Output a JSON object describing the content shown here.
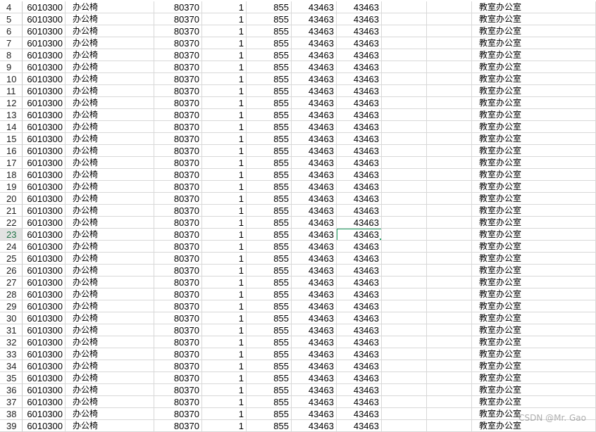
{
  "sheet": {
    "rows": [
      {
        "n": "4",
        "a": "6010300",
        "b": "办公椅",
        "c": "80370",
        "d": "1",
        "e": "855",
        "f": "43463",
        "g": "43463",
        "h": "教室办公室"
      },
      {
        "n": "5",
        "a": "6010300",
        "b": "办公椅",
        "c": "80370",
        "d": "1",
        "e": "855",
        "f": "43463",
        "g": "43463",
        "h": "教室办公室"
      },
      {
        "n": "6",
        "a": "6010300",
        "b": "办公椅",
        "c": "80370",
        "d": "1",
        "e": "855",
        "f": "43463",
        "g": "43463",
        "h": "教室办公室"
      },
      {
        "n": "7",
        "a": "6010300",
        "b": "办公椅",
        "c": "80370",
        "d": "1",
        "e": "855",
        "f": "43463",
        "g": "43463",
        "h": "教室办公室"
      },
      {
        "n": "8",
        "a": "6010300",
        "b": "办公椅",
        "c": "80370",
        "d": "1",
        "e": "855",
        "f": "43463",
        "g": "43463",
        "h": "教室办公室"
      },
      {
        "n": "9",
        "a": "6010300",
        "b": "办公椅",
        "c": "80370",
        "d": "1",
        "e": "855",
        "f": "43463",
        "g": "43463",
        "h": "教室办公室"
      },
      {
        "n": "10",
        "a": "6010300",
        "b": "办公椅",
        "c": "80370",
        "d": "1",
        "e": "855",
        "f": "43463",
        "g": "43463",
        "h": "教室办公室"
      },
      {
        "n": "11",
        "a": "6010300",
        "b": "办公椅",
        "c": "80370",
        "d": "1",
        "e": "855",
        "f": "43463",
        "g": "43463",
        "h": "教室办公室"
      },
      {
        "n": "12",
        "a": "6010300",
        "b": "办公椅",
        "c": "80370",
        "d": "1",
        "e": "855",
        "f": "43463",
        "g": "43463",
        "h": "教室办公室"
      },
      {
        "n": "13",
        "a": "6010300",
        "b": "办公椅",
        "c": "80370",
        "d": "1",
        "e": "855",
        "f": "43463",
        "g": "43463",
        "h": "教室办公室"
      },
      {
        "n": "14",
        "a": "6010300",
        "b": "办公椅",
        "c": "80370",
        "d": "1",
        "e": "855",
        "f": "43463",
        "g": "43463",
        "h": "教室办公室"
      },
      {
        "n": "15",
        "a": "6010300",
        "b": "办公椅",
        "c": "80370",
        "d": "1",
        "e": "855",
        "f": "43463",
        "g": "43463",
        "h": "教室办公室"
      },
      {
        "n": "16",
        "a": "6010300",
        "b": "办公椅",
        "c": "80370",
        "d": "1",
        "e": "855",
        "f": "43463",
        "g": "43463",
        "h": "教室办公室"
      },
      {
        "n": "17",
        "a": "6010300",
        "b": "办公椅",
        "c": "80370",
        "d": "1",
        "e": "855",
        "f": "43463",
        "g": "43463",
        "h": "教室办公室"
      },
      {
        "n": "18",
        "a": "6010300",
        "b": "办公椅",
        "c": "80370",
        "d": "1",
        "e": "855",
        "f": "43463",
        "g": "43463",
        "h": "教室办公室"
      },
      {
        "n": "19",
        "a": "6010300",
        "b": "办公椅",
        "c": "80370",
        "d": "1",
        "e": "855",
        "f": "43463",
        "g": "43463",
        "h": "教室办公室"
      },
      {
        "n": "20",
        "a": "6010300",
        "b": "办公椅",
        "c": "80370",
        "d": "1",
        "e": "855",
        "f": "43463",
        "g": "43463",
        "h": "教室办公室"
      },
      {
        "n": "21",
        "a": "6010300",
        "b": "办公椅",
        "c": "80370",
        "d": "1",
        "e": "855",
        "f": "43463",
        "g": "43463",
        "h": "教室办公室"
      },
      {
        "n": "22",
        "a": "6010300",
        "b": "办公椅",
        "c": "80370",
        "d": "1",
        "e": "855",
        "f": "43463",
        "g": "43463",
        "h": "教室办公室"
      },
      {
        "n": "23",
        "a": "6010300",
        "b": "办公椅",
        "c": "80370",
        "d": "1",
        "e": "855",
        "f": "43463",
        "g": "43463",
        "h": "教室办公室"
      },
      {
        "n": "24",
        "a": "6010300",
        "b": "办公椅",
        "c": "80370",
        "d": "1",
        "e": "855",
        "f": "43463",
        "g": "43463",
        "h": "教室办公室"
      },
      {
        "n": "25",
        "a": "6010300",
        "b": "办公椅",
        "c": "80370",
        "d": "1",
        "e": "855",
        "f": "43463",
        "g": "43463",
        "h": "教室办公室"
      },
      {
        "n": "26",
        "a": "6010300",
        "b": "办公椅",
        "c": "80370",
        "d": "1",
        "e": "855",
        "f": "43463",
        "g": "43463",
        "h": "教室办公室"
      },
      {
        "n": "27",
        "a": "6010300",
        "b": "办公椅",
        "c": "80370",
        "d": "1",
        "e": "855",
        "f": "43463",
        "g": "43463",
        "h": "教室办公室"
      },
      {
        "n": "28",
        "a": "6010300",
        "b": "办公椅",
        "c": "80370",
        "d": "1",
        "e": "855",
        "f": "43463",
        "g": "43463",
        "h": "教室办公室"
      },
      {
        "n": "29",
        "a": "6010300",
        "b": "办公椅",
        "c": "80370",
        "d": "1",
        "e": "855",
        "f": "43463",
        "g": "43463",
        "h": "教室办公室"
      },
      {
        "n": "30",
        "a": "6010300",
        "b": "办公椅",
        "c": "80370",
        "d": "1",
        "e": "855",
        "f": "43463",
        "g": "43463",
        "h": "教室办公室"
      },
      {
        "n": "31",
        "a": "6010300",
        "b": "办公椅",
        "c": "80370",
        "d": "1",
        "e": "855",
        "f": "43463",
        "g": "43463",
        "h": "教室办公室"
      },
      {
        "n": "32",
        "a": "6010300",
        "b": "办公椅",
        "c": "80370",
        "d": "1",
        "e": "855",
        "f": "43463",
        "g": "43463",
        "h": "教室办公室"
      },
      {
        "n": "33",
        "a": "6010300",
        "b": "办公椅",
        "c": "80370",
        "d": "1",
        "e": "855",
        "f": "43463",
        "g": "43463",
        "h": "教室办公室"
      },
      {
        "n": "34",
        "a": "6010300",
        "b": "办公椅",
        "c": "80370",
        "d": "1",
        "e": "855",
        "f": "43463",
        "g": "43463",
        "h": "教室办公室"
      },
      {
        "n": "35",
        "a": "6010300",
        "b": "办公椅",
        "c": "80370",
        "d": "1",
        "e": "855",
        "f": "43463",
        "g": "43463",
        "h": "教室办公室"
      },
      {
        "n": "36",
        "a": "6010300",
        "b": "办公椅",
        "c": "80370",
        "d": "1",
        "e": "855",
        "f": "43463",
        "g": "43463",
        "h": "教室办公室"
      },
      {
        "n": "37",
        "a": "6010300",
        "b": "办公椅",
        "c": "80370",
        "d": "1",
        "e": "855",
        "f": "43463",
        "g": "43463",
        "h": "教室办公室"
      },
      {
        "n": "38",
        "a": "6010300",
        "b": "办公椅",
        "c": "80370",
        "d": "1",
        "e": "855",
        "f": "43463",
        "g": "43463",
        "h": "教室办公室"
      },
      {
        "n": "39",
        "a": "6010300",
        "b": "办公椅",
        "c": "80370",
        "d": "1",
        "e": "855",
        "f": "43463",
        "g": "43463",
        "h": "教室办公室"
      }
    ],
    "active_row": "23",
    "selection_color": "#21a366",
    "active_row_header_color": "#217346"
  },
  "watermark": "CSDN @Mr. Gao"
}
